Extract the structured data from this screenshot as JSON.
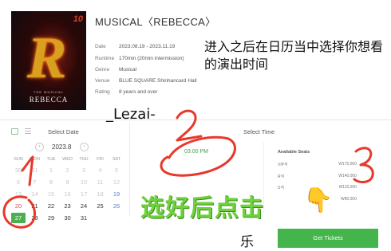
{
  "poster": {
    "number": "10",
    "letter": "R",
    "title": "REBECCA",
    "sub": "THE MUSICAL"
  },
  "show": {
    "title": "MUSICAL〈REBECCA〉",
    "info": [
      {
        "key": "Date",
        "value": "2023.08.19 - 2023.11.19"
      },
      {
        "key": "Runtime",
        "value": "170min (20min intermission)"
      },
      {
        "key": "Genre",
        "value": "Musical"
      },
      {
        "key": "Venue",
        "value": "BLUE SQUARE Shinhancard Hall"
      },
      {
        "key": "Rating",
        "value": "8 years and over"
      }
    ]
  },
  "annotations": {
    "note": "进入之后在日历当中选择你想看的演出时间",
    "author": "_Lezai-",
    "mark_1": "1",
    "mark_2": "2",
    "mark_3": "3",
    "cta": "选好后点击",
    "le": "乐"
  },
  "booking": {
    "select_date_label": "Select Date",
    "select_time_label": "Select Time",
    "month": "2023.8",
    "weekdays": [
      "SUN",
      "MON",
      "TUE",
      "WED",
      "THU",
      "FRI",
      "SAT"
    ],
    "weeks": [
      [
        "30",
        "31",
        "1",
        "2",
        "3",
        "4",
        "5"
      ],
      [
        "6",
        "7",
        "8",
        "9",
        "10",
        "11",
        "12"
      ],
      [
        "13",
        "14",
        "15",
        "16",
        "17",
        "18",
        "19"
      ],
      [
        "20",
        "21",
        "22",
        "23",
        "24",
        "25",
        "26"
      ],
      [
        "27",
        "28",
        "29",
        "30",
        "31",
        "",
        ""
      ]
    ],
    "first_active_day": "19",
    "selected_day": "27",
    "time": "03:00 PM",
    "available_seats_label": "Available Seats",
    "seats": [
      {
        "grade": "VIP석",
        "price": "W170,000"
      },
      {
        "grade": "R석",
        "price": "W140,000"
      },
      {
        "grade": "S석",
        "price": "W110,000"
      },
      {
        "grade": "",
        "price": "W80,000"
      }
    ],
    "get_tickets_label": "Get Tickets"
  },
  "colors": {
    "accent_green": "#43b54b",
    "annotation_red": "#e8382c",
    "annotation_text_green": "#6ed13d"
  }
}
